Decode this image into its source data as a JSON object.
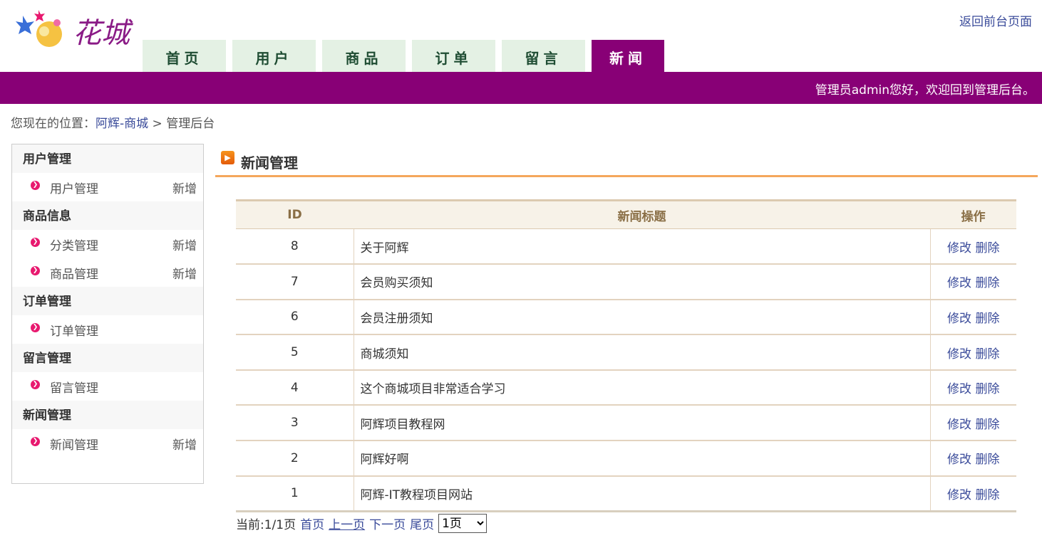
{
  "logo": {
    "text": "花城"
  },
  "header": {
    "back_link": "返回前台页面",
    "welcome": "管理员admin您好，欢迎回到管理后台。"
  },
  "nav": {
    "tabs": [
      "首页",
      "用户",
      "商品",
      "订单",
      "留言",
      "新闻"
    ],
    "active": "新闻"
  },
  "breadcrumb": {
    "prefix": "您现在的位置：",
    "home": "阿辉-商城",
    "sep": " > ",
    "current": "管理后台"
  },
  "sidebar": {
    "groups": [
      {
        "title": "用户管理",
        "items": [
          {
            "label": "用户管理",
            "add": "新增"
          }
        ]
      },
      {
        "title": "商品信息",
        "items": [
          {
            "label": "分类管理",
            "add": "新增"
          },
          {
            "label": "商品管理",
            "add": "新增"
          }
        ]
      },
      {
        "title": "订单管理",
        "items": [
          {
            "label": "订单管理",
            "add": ""
          }
        ]
      },
      {
        "title": "留言管理",
        "items": [
          {
            "label": "留言管理",
            "add": ""
          }
        ]
      },
      {
        "title": "新闻管理",
        "items": [
          {
            "label": "新闻管理",
            "add": "新增"
          }
        ]
      }
    ]
  },
  "main": {
    "title": "新闻管理",
    "table": {
      "headers": [
        "ID",
        "新闻标题",
        "操作"
      ],
      "rows": [
        {
          "id": "8",
          "title": "关于阿辉",
          "edit": "修改",
          "delete": "删除"
        },
        {
          "id": "7",
          "title": "会员购买须知",
          "edit": "修改",
          "delete": "删除"
        },
        {
          "id": "6",
          "title": "会员注册须知",
          "edit": "修改",
          "delete": "删除"
        },
        {
          "id": "5",
          "title": "商城须知",
          "edit": "修改",
          "delete": "删除"
        },
        {
          "id": "4",
          "title": "这个商城项目非常适合学习",
          "edit": "修改",
          "delete": "删除"
        },
        {
          "id": "3",
          "title": "阿辉项目教程网",
          "edit": "修改",
          "delete": "删除"
        },
        {
          "id": "2",
          "title": "阿辉好啊",
          "edit": "修改",
          "delete": "删除"
        },
        {
          "id": "1",
          "title": "阿辉-IT教程项目网站",
          "edit": "修改",
          "delete": "删除"
        }
      ]
    },
    "pager": {
      "status": "当前:1/1页",
      "first": "首页",
      "prev": "上一页",
      "next": "下一页",
      "last": "尾页",
      "select_value": "1页",
      "options": [
        "1页"
      ]
    }
  },
  "colors": {
    "brand": "#880076",
    "tab_bg": "#e4f1e4",
    "accent_line": "#f4a75c",
    "link": "#3a4b9a"
  }
}
